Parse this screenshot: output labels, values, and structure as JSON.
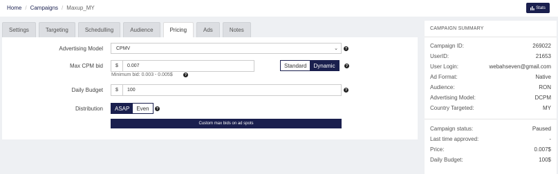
{
  "breadcrumb": {
    "home": "Home",
    "campaigns": "Campaigns",
    "current": "Maxup_MY",
    "sep": "/"
  },
  "stats_button": {
    "label": "Stats"
  },
  "tabs": [
    "Settings",
    "Targeting",
    "Schedulling",
    "Audience",
    "Pricing",
    "Ads",
    "Notes"
  ],
  "active_tab": "Pricing",
  "form": {
    "advertising_model": {
      "label": "Advertising Model",
      "value": "CPMV"
    },
    "max_cpm_bid": {
      "label": "Max CPM bid",
      "currency": "$",
      "value": "0.007",
      "hint": "Minimum bid: 0.003 - 0.005$"
    },
    "bid_mode": {
      "standard": "Standard",
      "dynamic": "Dynamic",
      "selected": "Dynamic"
    },
    "daily_budget": {
      "label": "Daily Budget",
      "currency": "$",
      "value": "100"
    },
    "distribution": {
      "label": "Distribution",
      "asap": "ASAP",
      "even": "Even",
      "selected": "ASAP"
    },
    "custom_bids_button": "Custom max bids on ad spots"
  },
  "summary": {
    "title": "CAMPAIGN SUMMARY",
    "rows": [
      {
        "label": "Campaign ID:",
        "value": "269022"
      },
      {
        "label": "UserID:",
        "value": "21653"
      },
      {
        "label": "User Login:",
        "value": "webahseven@gmail.com"
      },
      {
        "label": "Ad Format:",
        "value": "Native"
      },
      {
        "label": "Audience:",
        "value": "RON"
      },
      {
        "label": "Advertising Model:",
        "value": "DCPM"
      },
      {
        "label": "Country Targeted:",
        "value": "MY"
      }
    ],
    "status_rows": [
      {
        "label": "Campaign status:",
        "value": "Paused"
      },
      {
        "label": "Last time approved:",
        "value": "-"
      },
      {
        "label": "Price:",
        "value": "0.007$"
      },
      {
        "label": "Daily Budget:",
        "value": "100$"
      }
    ]
  },
  "colors": {
    "primary": "#1a1f4e",
    "background": "#eef0f3"
  }
}
